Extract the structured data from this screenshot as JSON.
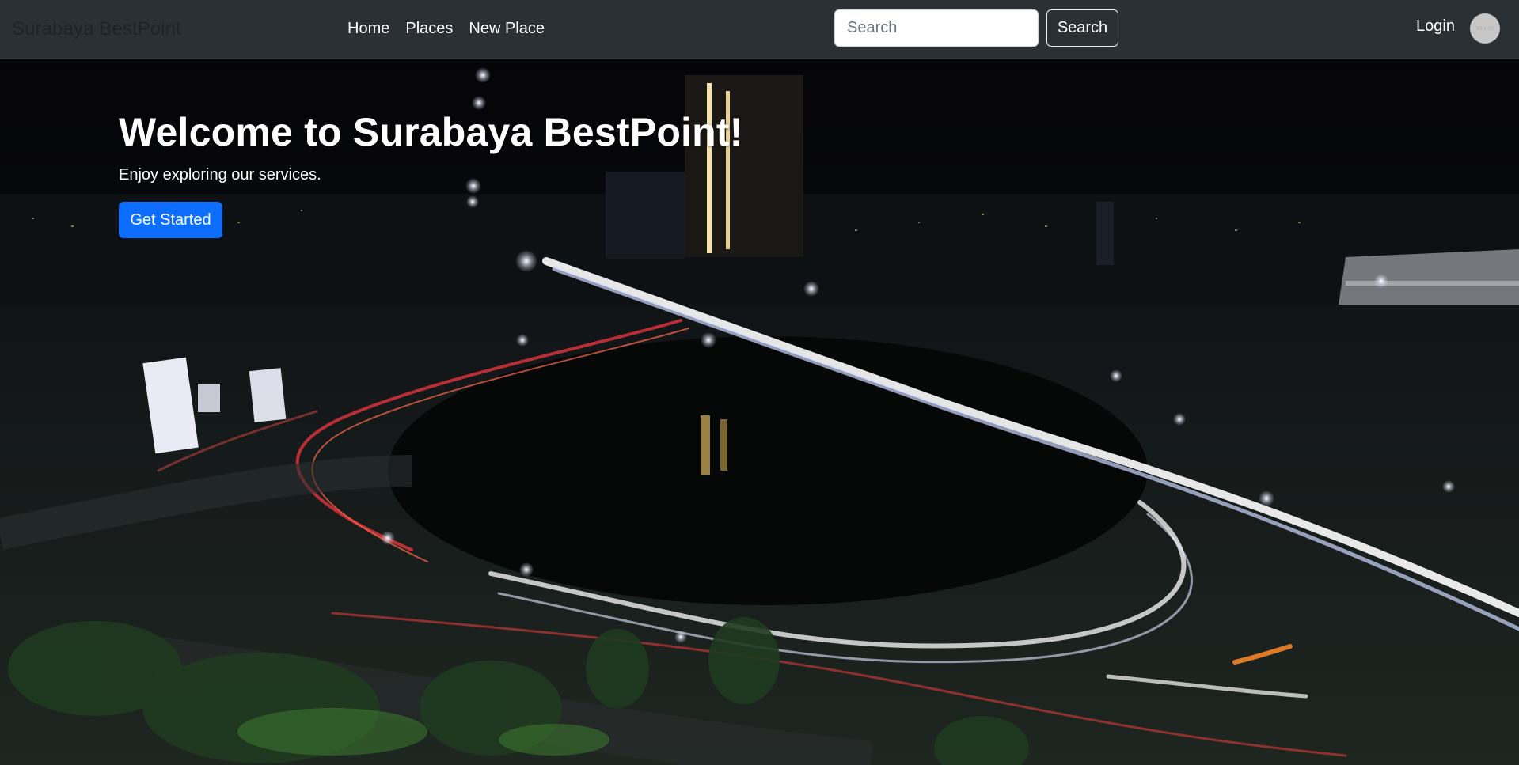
{
  "navbar": {
    "brand": "Surabaya BestPoint",
    "links": [
      {
        "label": "Home"
      },
      {
        "label": "Places"
      },
      {
        "label": "New Place"
      }
    ],
    "search": {
      "placeholder": "Search",
      "value": "",
      "button_label": "Search"
    },
    "login_label": "Login",
    "avatar_text": "50 x 50"
  },
  "hero": {
    "title": "Welcome to Surabaya BestPoint!",
    "subtitle": "Enjoy exploring our services.",
    "cta_label": "Get Started"
  },
  "colors": {
    "navbar_bg": "#2b3035",
    "primary": "#0d6efd",
    "hero_text": "#ffffff"
  }
}
